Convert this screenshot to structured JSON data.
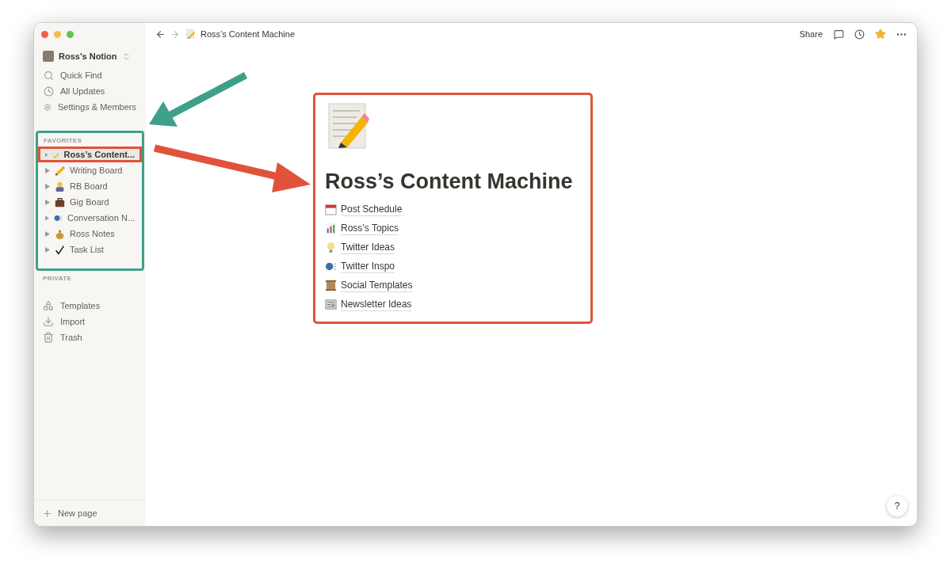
{
  "workspace": {
    "name": "Ross's Notion"
  },
  "sidebar_actions": [
    "Quick Find",
    "All Updates",
    "Settings & Members"
  ],
  "favorites": {
    "heading": "FAVORITES",
    "items": [
      {
        "label": "Ross’s Content...",
        "selected": true
      },
      {
        "label": "Writing Board",
        "selected": false
      },
      {
        "label": "RB Board",
        "selected": false
      },
      {
        "label": "Gig Board",
        "selected": false
      },
      {
        "label": "Conversation N...",
        "selected": false
      },
      {
        "label": "Ross Notes",
        "selected": false
      },
      {
        "label": "Task List",
        "selected": false
      }
    ]
  },
  "private": {
    "heading": "PRIVATE"
  },
  "sidebar_tools": [
    "Templates",
    "Import",
    "Trash"
  ],
  "new_page": "New page",
  "topbar": {
    "breadcrumb": "Ross’s Content Machine",
    "share": "Share",
    "favorited": true
  },
  "page": {
    "title": "Ross’s Content Machine",
    "links": [
      "Post Schedule",
      "Ross’s Topics",
      "Twitter Ideas",
      "Twitter Inspo",
      "Social Templates",
      "Newsletter Ideas"
    ]
  },
  "help": "?"
}
